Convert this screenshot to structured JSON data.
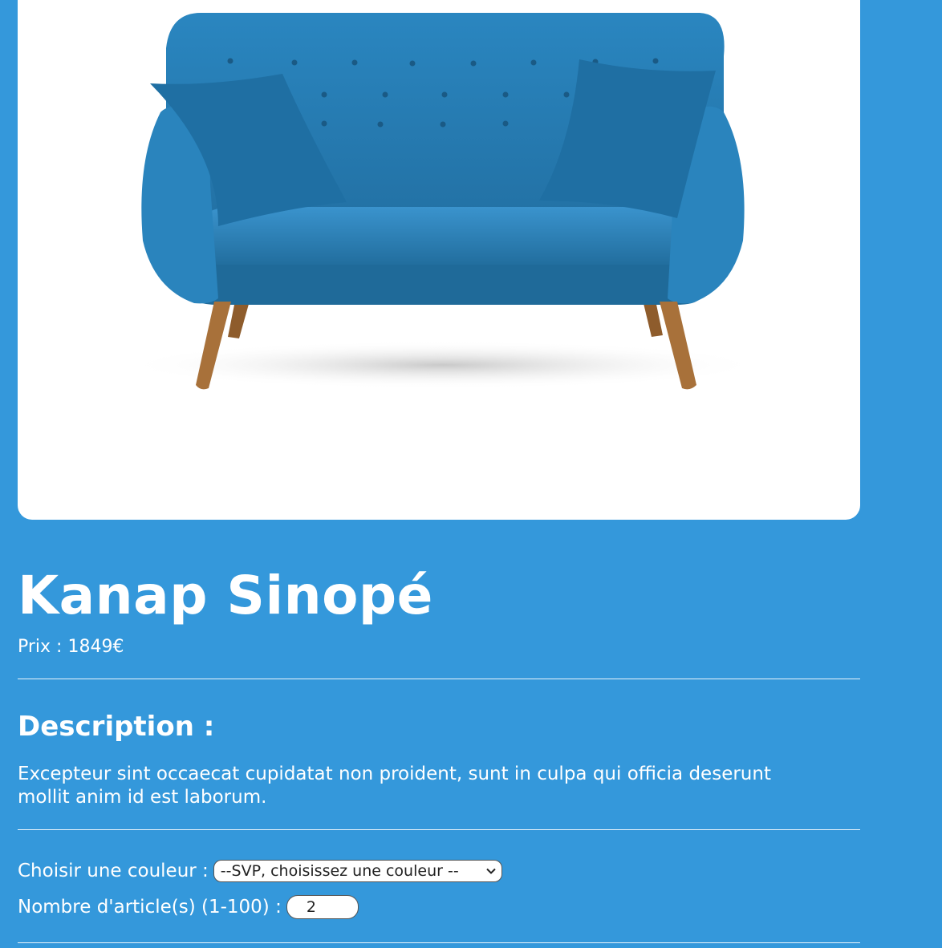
{
  "product": {
    "name": "Kanap Sinopé",
    "price_label": "Prix : 1849€",
    "image_alt": "blue sofa",
    "colors": {
      "background": "#3498db",
      "sofa": "#2b7fb3",
      "sofa_dark": "#1f6a99",
      "legs": "#a8713a"
    }
  },
  "description": {
    "heading": "Description :",
    "text": "Excepteur sint occaecat cupidatat non proident, sunt in culpa qui officia deserunt mollit anim id est laborum."
  },
  "options": {
    "color_label": "Choisir une couleur :",
    "color_selected": "--SVP, choisissez une couleur --",
    "quantity_label": "Nombre d'article(s) (1-100) :",
    "quantity_value": "2"
  }
}
